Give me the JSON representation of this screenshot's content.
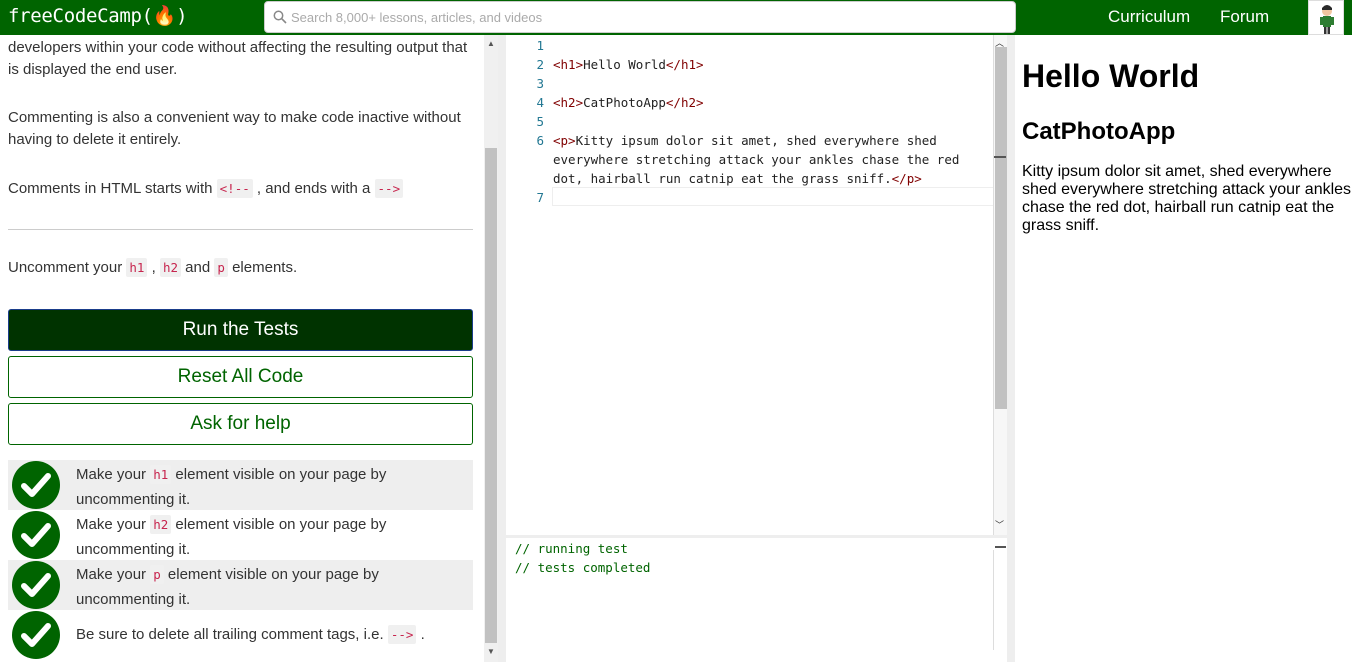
{
  "nav": {
    "logo": "freeCodeCamp(🔥)",
    "search_placeholder": "Search 8,000+ lessons, articles, and videos",
    "curriculum": "Curriculum",
    "forum": "Forum"
  },
  "lesson": {
    "para1": "developers within your code without affecting the resulting output that is displayed the end user.",
    "para2": "Commenting is also a convenient way to make code inactive without having to delete it entirely.",
    "para3_a": "Comments in HTML starts with ",
    "para3_code1": "<!--",
    "para3_b": " , and ends with a ",
    "para3_code2": "-->",
    "task_a": "Uncomment your ",
    "task_h1": "h1",
    "task_sep1": " , ",
    "task_h2": "h2",
    "task_and": " and ",
    "task_p": "p",
    "task_b": " elements."
  },
  "buttons": {
    "run": "Run the Tests",
    "reset": "Reset All Code",
    "help": "Ask for help"
  },
  "tests": [
    {
      "pre": "Make your ",
      "code": "h1",
      "post": " element visible on your page by uncommenting it."
    },
    {
      "pre": "Make your ",
      "code": "h2",
      "post": " element visible on your page by uncommenting it."
    },
    {
      "pre": "Make your ",
      "code": "p",
      "post": " element visible on your page by uncommenting it."
    },
    {
      "pre": "Be sure to delete all trailing comment tags, i.e. ",
      "code": "-->",
      "post": " ."
    }
  ],
  "editor": {
    "lines": [
      {
        "num": "1",
        "text": ""
      },
      {
        "num": "2",
        "text": "<h1>Hello World</h1>"
      },
      {
        "num": "3",
        "text": ""
      },
      {
        "num": "4",
        "text": "<h2>CatPhotoApp</h2>"
      },
      {
        "num": "5",
        "text": ""
      },
      {
        "num": "6",
        "text": "<p>Kitty ipsum dolor sit amet, shed everywhere shed everywhere stretching attack your ankles chase the red dot, hairball run catnip eat the grass sniff.</p>"
      },
      {
        "num": "7",
        "text": ""
      }
    ]
  },
  "output": {
    "line1": "// running test",
    "line2": "// tests completed"
  },
  "preview": {
    "h1": "Hello World",
    "h2": "CatPhotoApp",
    "p": "Kitty ipsum dolor sit amet, shed everywhere shed everywhere stretching attack your ankles chase the red dot, hairball run catnip eat the grass sniff."
  },
  "colors": {
    "brand_green": "#006400",
    "run_button_bg": "#003300",
    "tag_color": "#800000",
    "code_pink": "#c7254e"
  }
}
